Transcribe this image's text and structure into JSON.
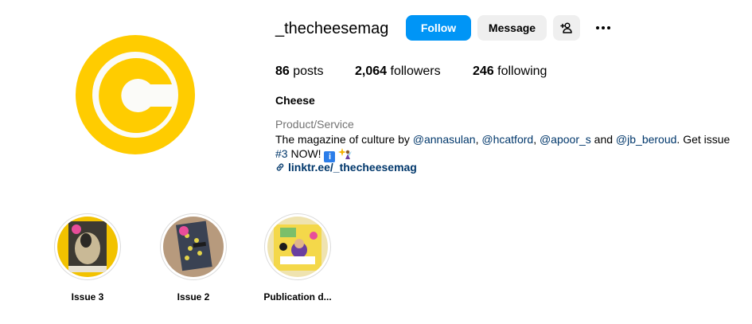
{
  "profile": {
    "username": "_thecheesemag",
    "avatar_icon": "cheese-c-logo",
    "colors": {
      "brand_yellow": "#ffcc00",
      "follow_blue": "#0095f6",
      "link": "#00376b"
    }
  },
  "actions": {
    "follow_label": "Follow",
    "message_label": "Message",
    "add_user_icon": "person-add-icon",
    "more_icon": "more-horizontal-icon"
  },
  "stats": {
    "posts_count": "86",
    "posts_label": "posts",
    "followers_count": "2,064",
    "followers_label": "followers",
    "following_count": "246",
    "following_label": "following"
  },
  "bio": {
    "name": "Cheese",
    "category": "Product/Service",
    "text_1": "The magazine of culture by ",
    "mention_1": "@annasulan",
    "sep_1": ", ",
    "mention_2": "@hcatford",
    "sep_2": ", ",
    "mention_3": "@apoor_s",
    "sep_3": " and ",
    "mention_4": "@jb_beroud",
    "text_2": ". Get issue ",
    "hashtag": "#3",
    "text_3": " NOW! ",
    "emoji_1": "ℹ️",
    "emoji_2": "sparkle-fairy",
    "link_icon": "link-icon",
    "link": "linktr.ee/_thecheesemag"
  },
  "highlights": [
    {
      "label": "Issue 3"
    },
    {
      "label": "Issue 2"
    },
    {
      "label": "Publication d..."
    }
  ]
}
